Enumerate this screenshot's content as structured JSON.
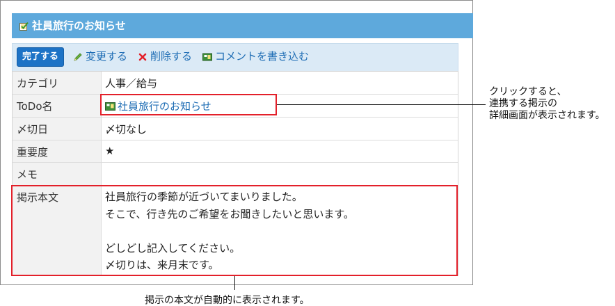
{
  "window": {
    "title": "社員旅行のお知らせ",
    "title_icon": "todo-check-icon"
  },
  "toolbar": {
    "complete_label": "完了する",
    "edit_label": "変更する",
    "delete_label": "削除する",
    "comment_label": "コメントを書き込む"
  },
  "fields": {
    "category": {
      "label": "カテゴリ",
      "value": "人事／給与"
    },
    "todo_name": {
      "label": "ToDo名",
      "value": "社員旅行のお知らせ"
    },
    "due_date": {
      "label": "〆切日",
      "value": "〆切なし"
    },
    "priority": {
      "label": "重要度",
      "value": "★"
    },
    "memo": {
      "label": "メモ",
      "value": ""
    },
    "post_body": {
      "label": "掲示本文",
      "lines": [
        "社員旅行の季節が近づいてまいりました。",
        "そこで、行き先のご希望をお聞きしたいと思います。",
        "",
        "どしどし記入してください。",
        "〆切りは、来月末です。"
      ]
    }
  },
  "annotations": {
    "link_note": [
      "クリックすると、",
      "連携する掲示の",
      "詳細画面が表示されます。"
    ],
    "body_note": "掲示の本文が自動的に表示されます。"
  },
  "colors": {
    "header_blue": "#5ea9dc",
    "toolbar_bg": "#dbeaf6",
    "button_blue": "#1d73c6",
    "link_blue": "#1d6cb4",
    "highlight_red": "#e3202a"
  }
}
